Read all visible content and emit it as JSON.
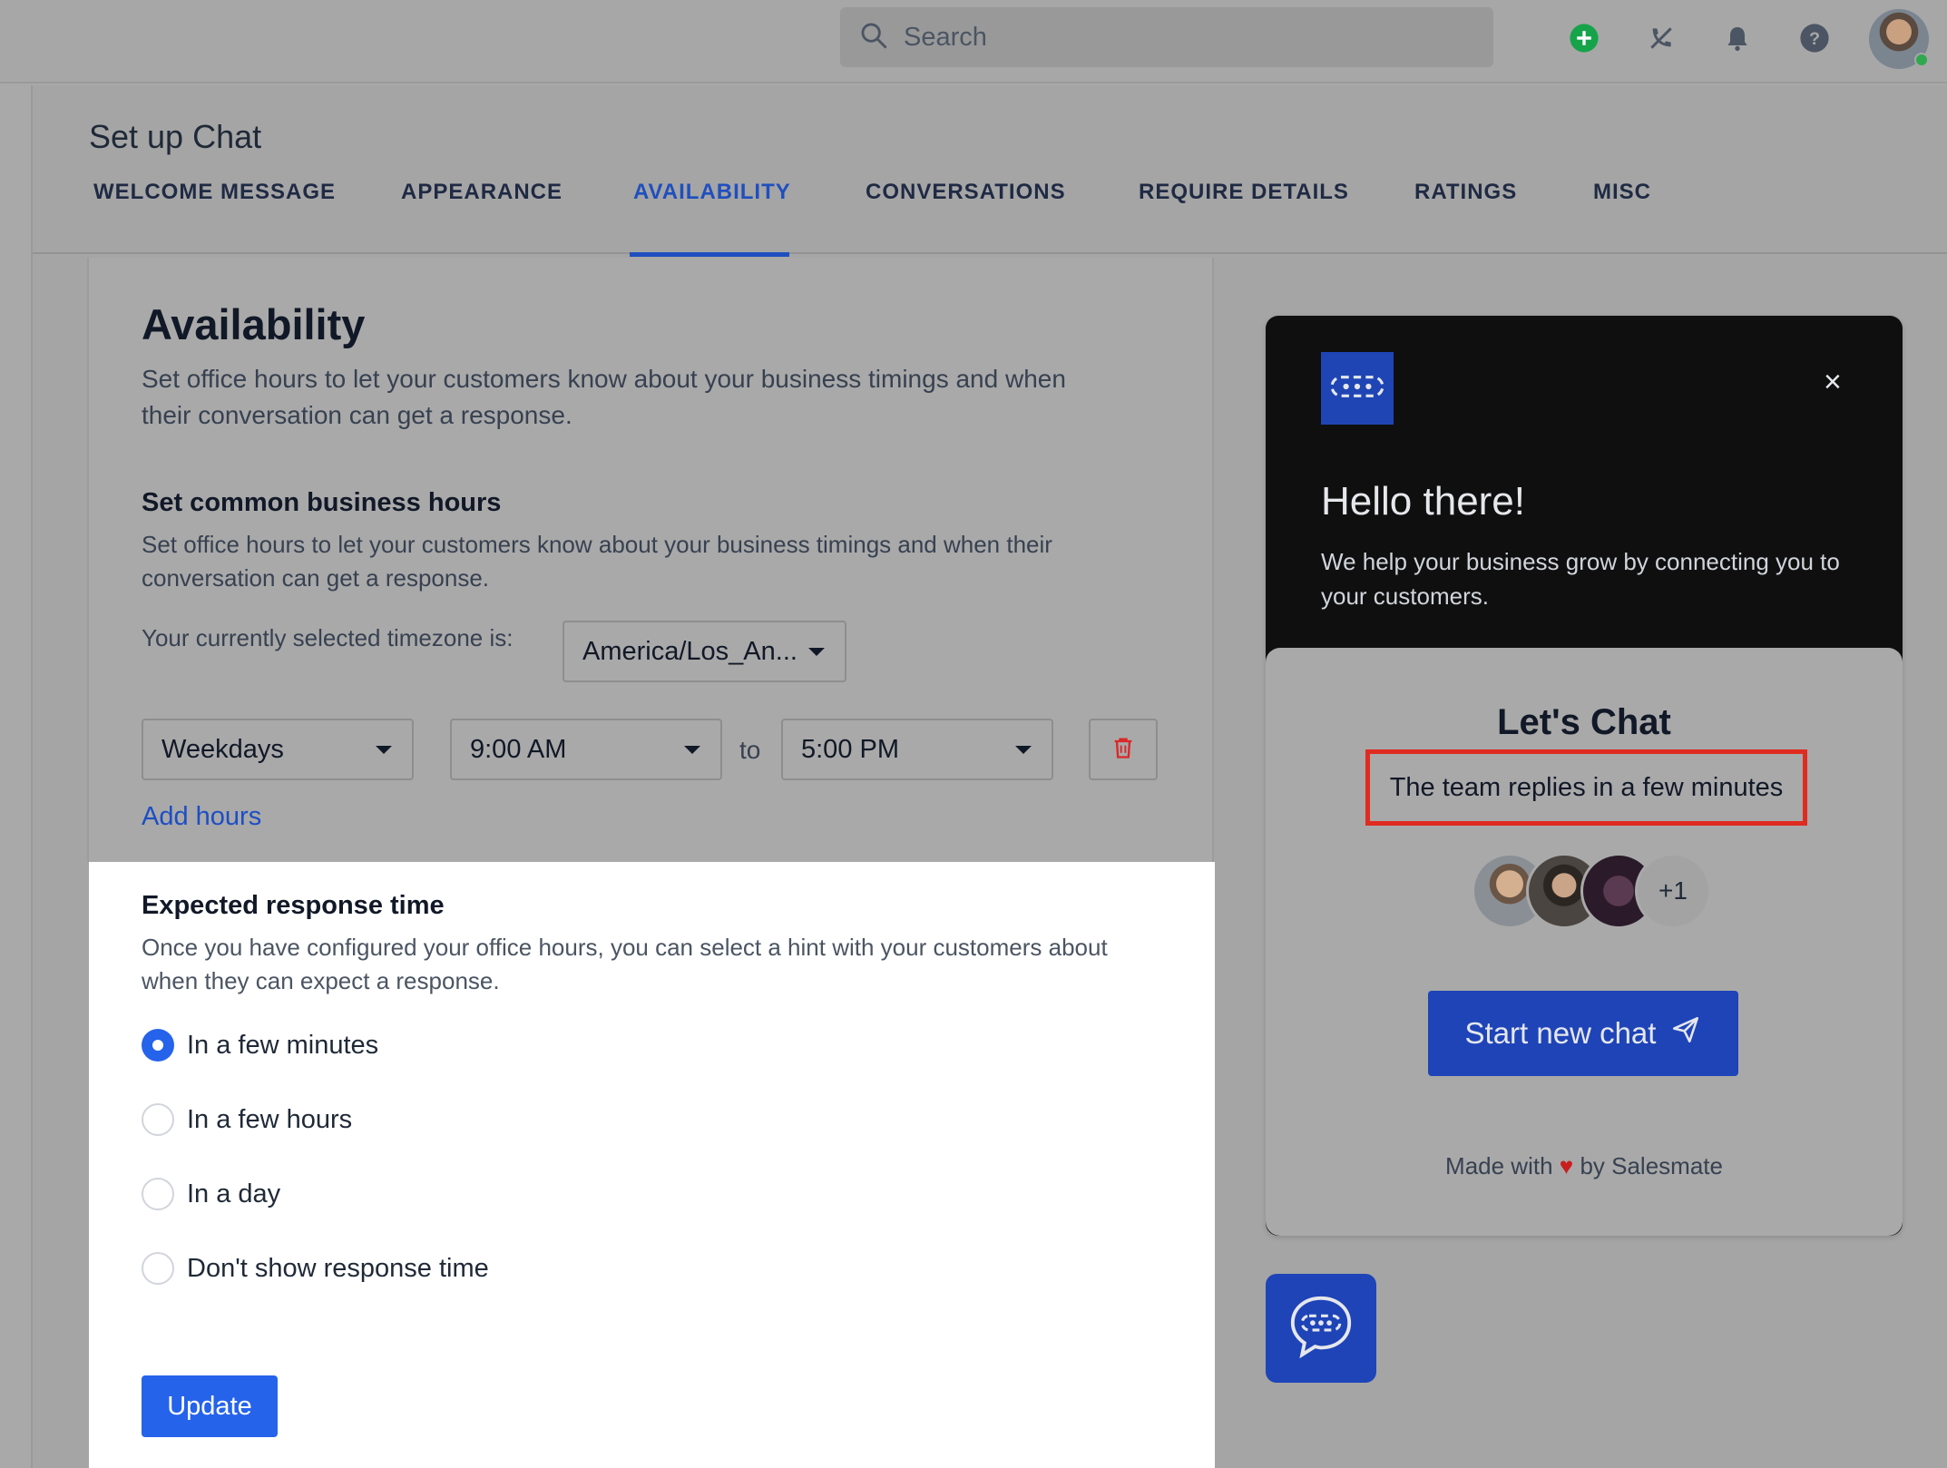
{
  "search": {
    "placeholder": "Search"
  },
  "page": {
    "title": "Set up Chat"
  },
  "tabs": [
    {
      "label": "WELCOME MESSAGE"
    },
    {
      "label": "APPEARANCE"
    },
    {
      "label": "AVAILABILITY"
    },
    {
      "label": "CONVERSATIONS"
    },
    {
      "label": "REQUIRE DETAILS"
    },
    {
      "label": "RATINGS"
    },
    {
      "label": "MISC"
    }
  ],
  "active_tab": "AVAILABILITY",
  "availability": {
    "heading": "Availability",
    "description": "Set office hours to let your customers know about your business timings and when their conversation can get a response."
  },
  "business_hours": {
    "heading": "Set common business hours",
    "description": "Set office hours to let your customers know about your business timings and when their conversation can get a response.",
    "timezone_label": "Your currently selected timezone is:",
    "timezone_value": "America/Los_An...",
    "day_value": "Weekdays",
    "start_time": "9:00 AM",
    "to_label": "to",
    "end_time": "5:00 PM",
    "add_hours_label": "Add hours"
  },
  "response_time": {
    "heading": "Expected response time",
    "description": "Once you have configured your office hours, you can select a hint with your customers about when they can expect a response.",
    "options": [
      {
        "label": "In a few minutes",
        "checked": true
      },
      {
        "label": "In a few hours",
        "checked": false
      },
      {
        "label": "In a day",
        "checked": false
      },
      {
        "label": "Don't show response time",
        "checked": false
      }
    ],
    "update_label": "Update"
  },
  "widget": {
    "greeting": "Hello there!",
    "subtitle": "We help your business grow by connecting you to your customers.",
    "lets_chat": "Let's Chat",
    "replies": "The team replies in a few minutes",
    "extra_agents": "+1",
    "start_chat_label": "Start new chat",
    "made_with_prefix": "Made with",
    "made_with_suffix": "by Salesmate",
    "close_symbol": "×"
  },
  "colors": {
    "accent": "#2563eb",
    "widget_blue": "#1e44b8",
    "highlight_red": "#e02b20",
    "add_green": "#16a34a"
  },
  "icons": [
    "search-icon",
    "add-circle-icon",
    "phone-off-icon",
    "bell-icon",
    "help-icon",
    "trash-icon",
    "send-icon",
    "chat-logo-icon",
    "heart-icon",
    "close-icon"
  ]
}
